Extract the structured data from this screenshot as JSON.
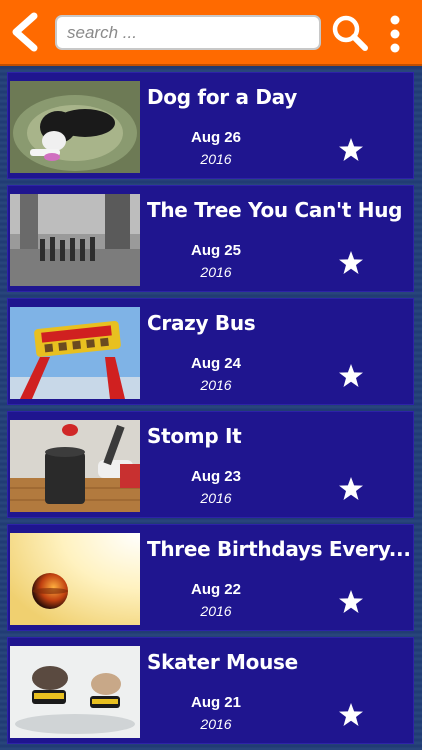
{
  "header": {
    "search_placeholder": "search ...",
    "back_icon": "chevron-left-icon",
    "search_icon": "magnifier-icon",
    "more_icon": "vertical-dots-icon",
    "accent_color": "#ff6a00"
  },
  "items": [
    {
      "title": "Dog for a Day",
      "date": "Aug 26",
      "year": "2016"
    },
    {
      "title": "The Tree You Can't Hug",
      "date": "Aug 25",
      "year": "2016"
    },
    {
      "title": "Crazy Bus",
      "date": "Aug 24",
      "year": "2016"
    },
    {
      "title": "Stomp It",
      "date": "Aug 23",
      "year": "2016"
    },
    {
      "title": "Three Birthdays Every...",
      "date": "Aug 22",
      "year": "2016"
    },
    {
      "title": "Skater Mouse",
      "date": "Aug 21",
      "year": "2016"
    }
  ],
  "card_color": "#1f158f"
}
